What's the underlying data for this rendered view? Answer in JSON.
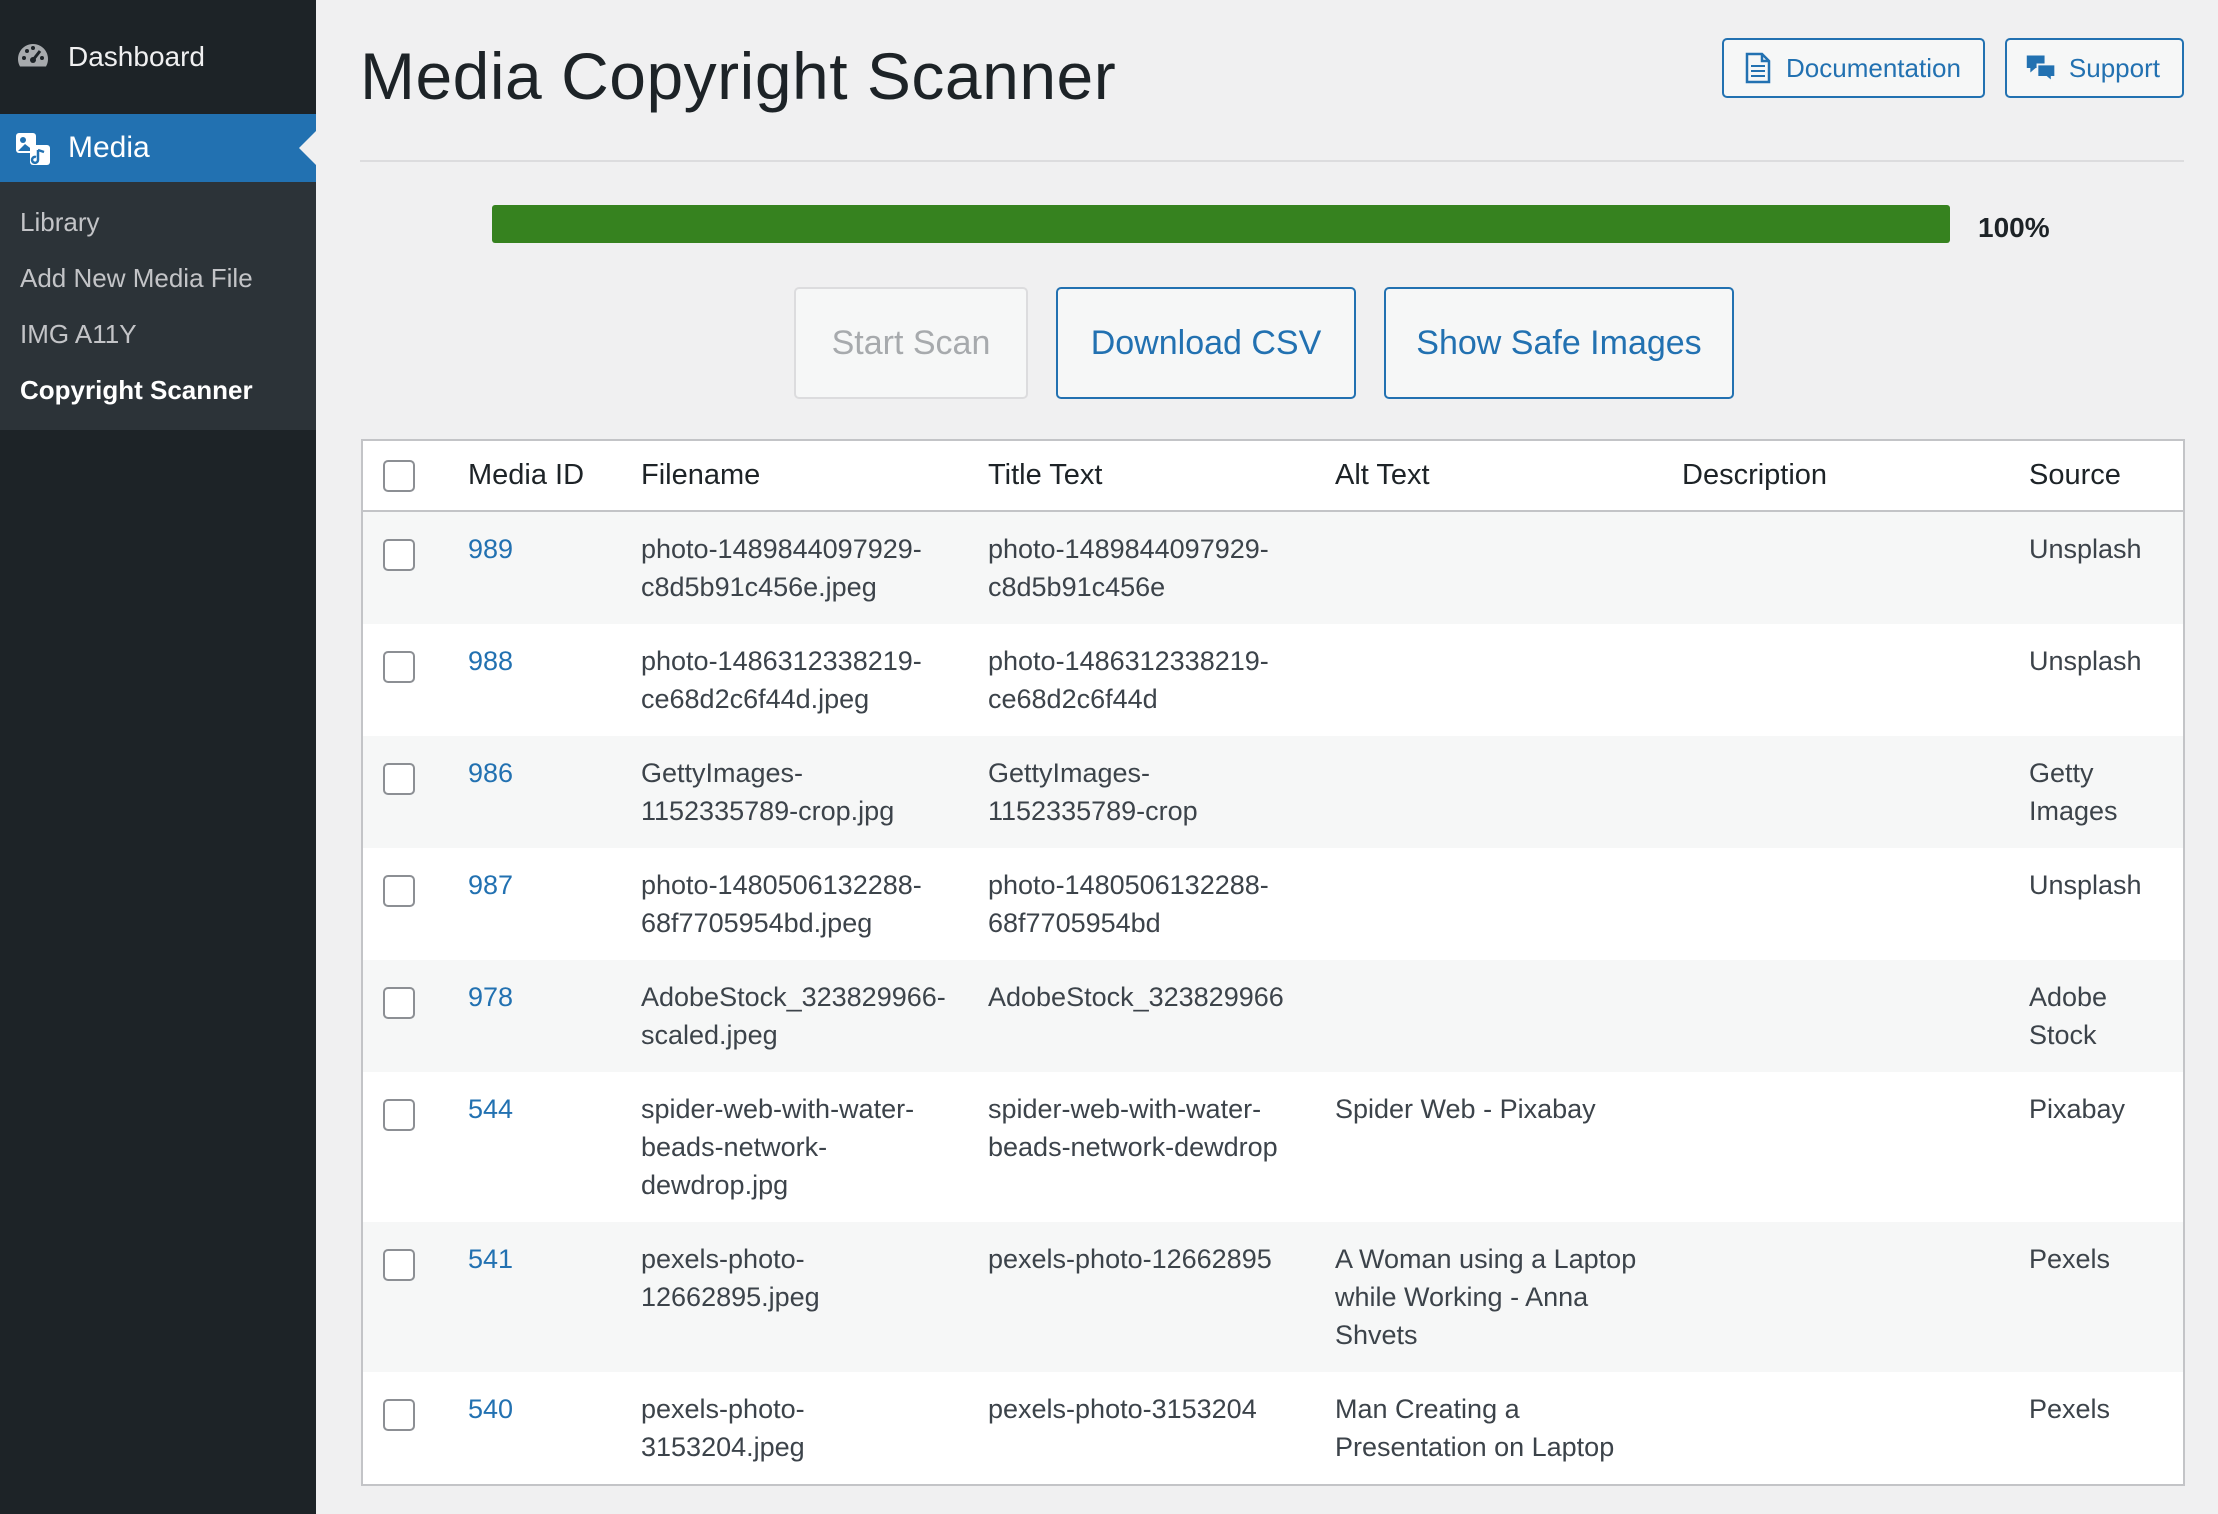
{
  "sidebar": {
    "dashboard_label": "Dashboard",
    "media_label": "Media",
    "submenu": [
      "Library",
      "Add New Media File",
      "IMG A11Y",
      "Copyright Scanner"
    ]
  },
  "page": {
    "title": "Media Copyright Scanner",
    "documentation_label": "Documentation",
    "support_label": "Support"
  },
  "progress": {
    "value": 1.0,
    "label": "100%",
    "color": "#36821f"
  },
  "actions": {
    "start_scan": "Start Scan",
    "download_csv": "Download CSV",
    "show_safe_images": "Show Safe Images"
  },
  "table": {
    "headers": {
      "media_id": "Media ID",
      "filename": "Filename",
      "title_text": "Title Text",
      "alt_text": "Alt Text",
      "description": "Description",
      "source": "Source"
    },
    "rows": [
      {
        "id": "989",
        "filename": "photo-1489844097929-c8d5b91c456e.jpeg",
        "title": "photo-1489844097929-c8d5b91c456e",
        "alt": "",
        "description": "",
        "source": "Unsplash"
      },
      {
        "id": "988",
        "filename": "photo-1486312338219-ce68d2c6f44d.jpeg",
        "title": "photo-1486312338219-ce68d2c6f44d",
        "alt": "",
        "description": "",
        "source": "Unsplash"
      },
      {
        "id": "986",
        "filename": "GettyImages-1152335789-crop.jpg",
        "title": "GettyImages-1152335789-crop",
        "alt": "",
        "description": "",
        "source": "Getty Images"
      },
      {
        "id": "987",
        "filename": "photo-1480506132288-68f7705954bd.jpeg",
        "title": "photo-1480506132288-68f7705954bd",
        "alt": "",
        "description": "",
        "source": "Unsplash"
      },
      {
        "id": "978",
        "filename": "AdobeStock_323829966-scaled.jpeg",
        "title": "AdobeStock_323829966",
        "alt": "",
        "description": "",
        "source": "Adobe Stock"
      },
      {
        "id": "544",
        "filename": "spider-web-with-water-beads-network-dewdrop.jpg",
        "title": "spider-web-with-water-beads-network-dewdrop",
        "alt": "Spider Web - Pixabay",
        "description": "",
        "source": "Pixabay"
      },
      {
        "id": "541",
        "filename": "pexels-photo-12662895.jpeg",
        "title": "pexels-photo-12662895",
        "alt": "A Woman using a Laptop while Working - Anna Shvets",
        "description": "",
        "source": "Pexels"
      },
      {
        "id": "540",
        "filename": "pexels-photo-3153204.jpeg",
        "title": "pexels-photo-3153204",
        "alt": "Man Creating a Presentation on Laptop",
        "description": "",
        "source": "Pexels"
      }
    ]
  }
}
